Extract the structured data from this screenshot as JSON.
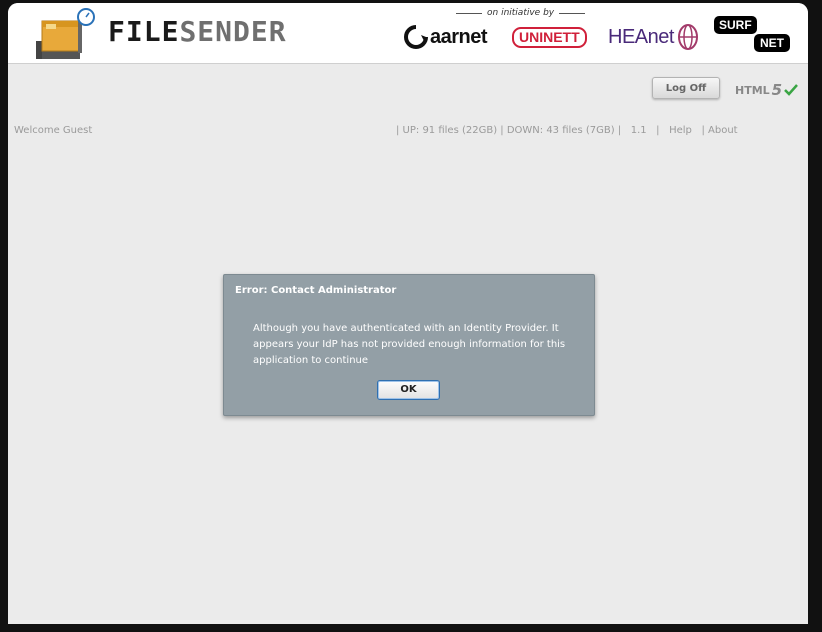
{
  "header": {
    "brand_part1": "FILE",
    "brand_part2": "SENDER",
    "initiative_text": "on initiative by",
    "partners": {
      "aarnet": "aarnet",
      "uninett": "UNINETT",
      "heanet": "HEAnet",
      "surf": "SURF",
      "net": "NET"
    }
  },
  "toolbar": {
    "logoff_label": "Log Off",
    "html_label": "HTML",
    "html_version": "5"
  },
  "status": {
    "welcome": "Welcome Guest",
    "nav_stats": "| UP: 91 files (22GB) | DOWN: 43 files (7GB) |",
    "version": "1.1",
    "sep1": "|",
    "help": "Help",
    "sep2": "|",
    "about": "About"
  },
  "dialog": {
    "title": "Error: Contact Administrator",
    "message": "Although you have authenticated with an Identity Provider. It appears your IdP has not provided enough information for this application to continue",
    "ok_label": "OK"
  },
  "colors": {
    "dialog_bg": "#939fa6",
    "page_bg": "#ebebeb",
    "check_green": "#3aa544"
  },
  "icons": [
    "filesender-logo-icon",
    "aarnet-logo-icon",
    "heanet-logo-icon",
    "check-icon"
  ]
}
